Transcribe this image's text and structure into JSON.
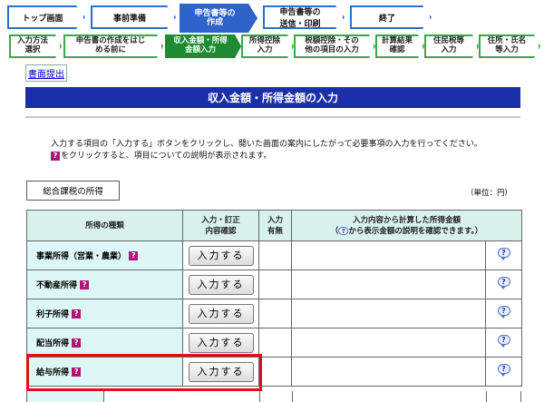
{
  "steps": [
    {
      "label": "トップ画面"
    },
    {
      "label": "事前準備"
    },
    {
      "label": "申告書等の\n作成"
    },
    {
      "label": "申告書等の\n送信・印刷"
    },
    {
      "label": "終了"
    }
  ],
  "substeps": [
    {
      "label": "入力方法\n選択"
    },
    {
      "label": "申告書の作成をはじ\nめる前に"
    },
    {
      "label": "収入金額・所得\n金額入力"
    },
    {
      "label": "所得控除\n入力"
    },
    {
      "label": "税額控除・その\n他の項目の入力"
    },
    {
      "label": "計算結果\n確認"
    },
    {
      "label": "住民税等\n入力"
    },
    {
      "label": "住所・氏名\n等入力"
    }
  ],
  "submit_link": "書面提出",
  "banner": "収入金額・所得金額の入力",
  "instructions": {
    "line1": "入力する項目の「入力する」ボタンをクリックし、開いた画面の案内にしたがって必要事項の入力を行ってください。",
    "line2": "をクリックすると、項目についての説明が表示されます。"
  },
  "section_title": "総合課税の所得",
  "unit": "（単位：円）",
  "table": {
    "headers": {
      "type": "所得の種類",
      "input": "入力・訂正\n内容確認",
      "has_input": "入力\n有無",
      "calc_line1": "入力内容から計算した所得金額",
      "calc_line2_pre": "（",
      "calc_line2_post": "から表示金額の説明を確認できます。）"
    },
    "rows": [
      {
        "label": "事業所得（営業・農業）",
        "button": "入力する"
      },
      {
        "label": "不動産所得",
        "button": "入力する"
      },
      {
        "label": "利子所得",
        "button": "入力する"
      },
      {
        "label": "配当所得",
        "button": "入力する"
      },
      {
        "label": "給与所得",
        "button": "入力する"
      }
    ]
  },
  "icons": {
    "question": "?"
  },
  "colors": {
    "banner": "#1a2fa8",
    "step_active": "#2f63c9",
    "sub_active": "#1e8a33",
    "highlight": "#e0101a"
  }
}
